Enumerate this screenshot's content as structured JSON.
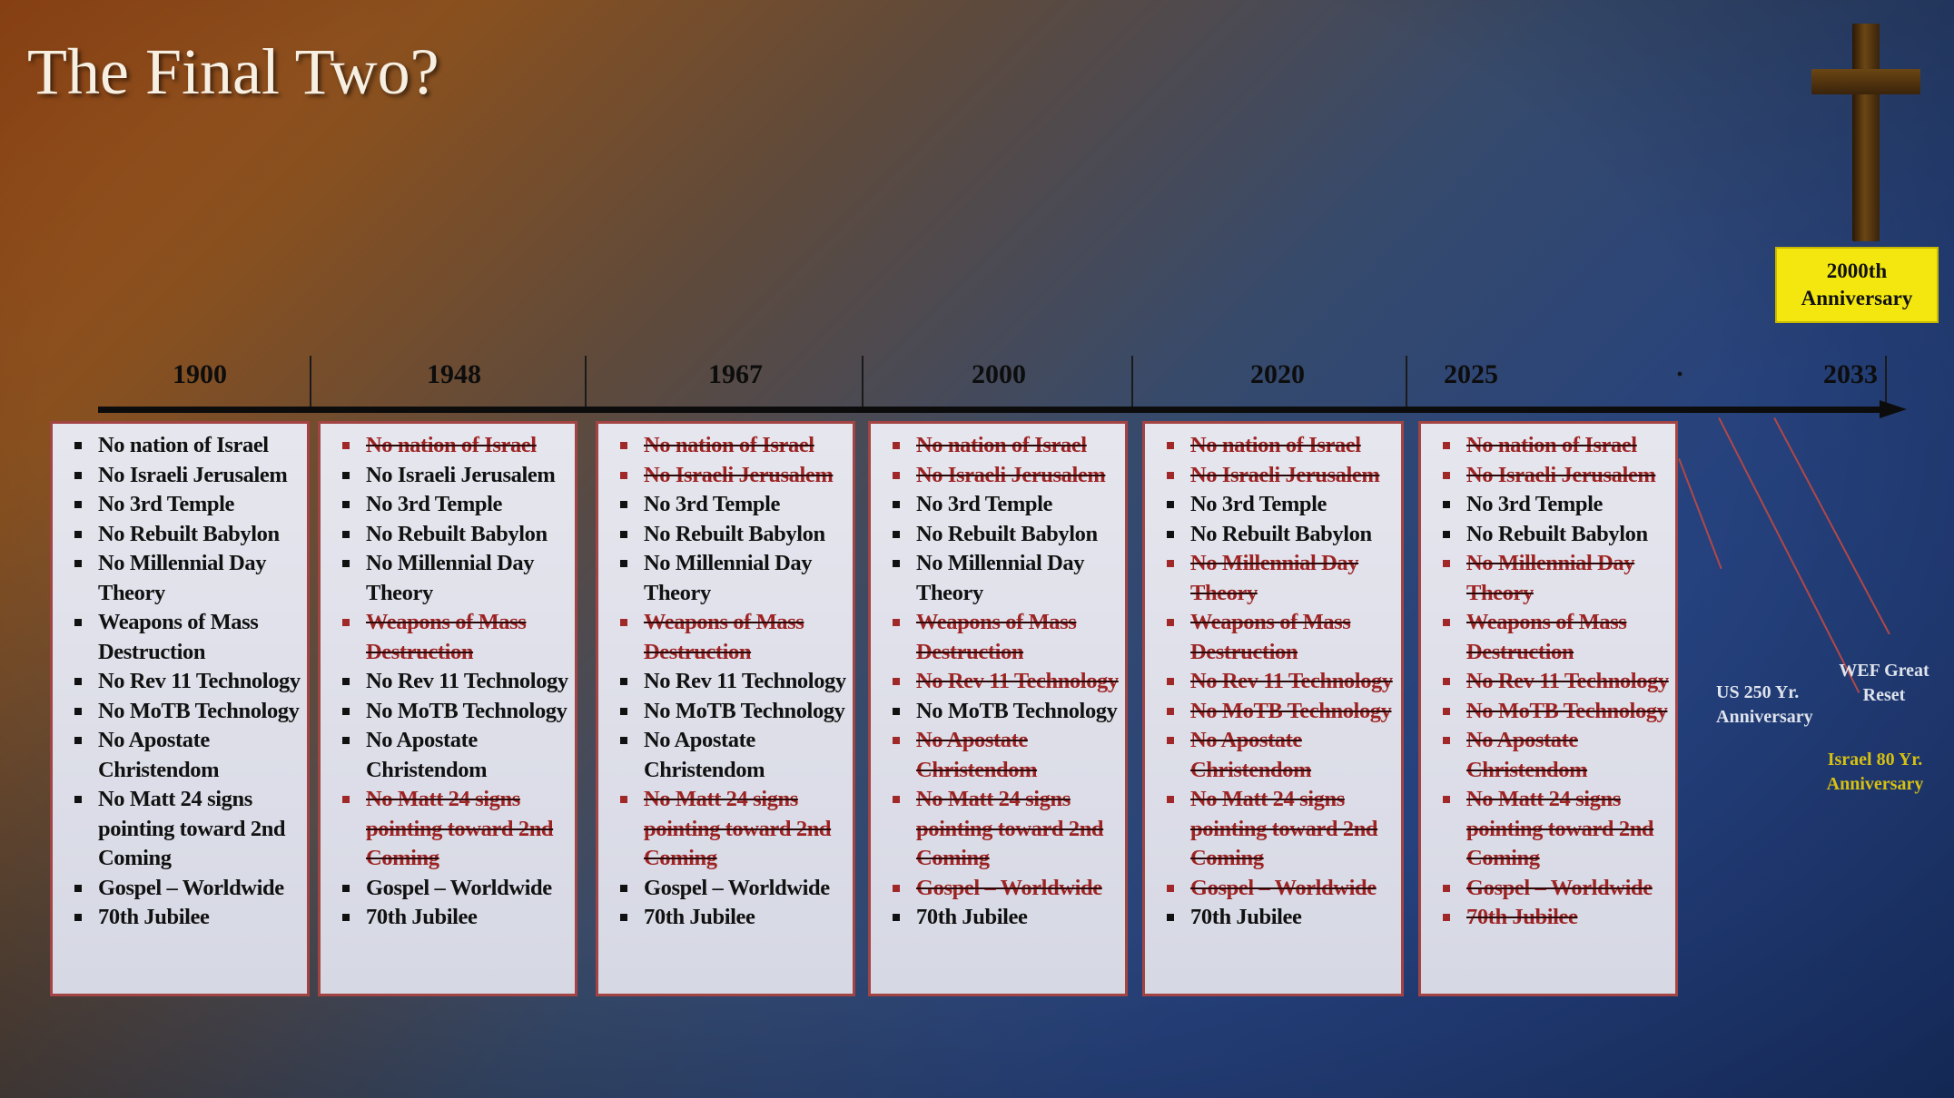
{
  "slide": {
    "title": "The Final Two?",
    "anniversary_label": "2000th Anniversary",
    "years": [
      "1900",
      "1948",
      "1967",
      "2000",
      "2020",
      "2025",
      "·",
      "2033"
    ],
    "columns": [
      {
        "year": "1900",
        "items": [
          {
            "text": "No nation of Israel",
            "struck": false
          },
          {
            "text": "No Israeli Jerusalem",
            "struck": false
          },
          {
            "text": "No 3rd Temple",
            "struck": false
          },
          {
            "text": "No Rebuilt Babylon",
            "struck": false
          },
          {
            "text": "No Millennial Day Theory",
            "struck": false
          },
          {
            "text": "Weapons of Mass Destruction",
            "struck": false
          },
          {
            "text": "No Rev 11 Technology",
            "struck": false
          },
          {
            "text": "No MoTB Technology",
            "struck": false
          },
          {
            "text": "No Apostate Christendom",
            "struck": false
          },
          {
            "text": "No Matt 24 signs pointing toward 2nd Coming",
            "struck": false
          },
          {
            "text": "Gospel – Worldwide",
            "struck": false
          },
          {
            "text": "70th Jubilee",
            "struck": false
          }
        ]
      },
      {
        "year": "1948",
        "items": [
          {
            "text": "No nation of Israel",
            "struck": true
          },
          {
            "text": "No Israeli Jerusalem",
            "struck": false
          },
          {
            "text": "No 3rd Temple",
            "struck": false
          },
          {
            "text": "No Rebuilt Babylon",
            "struck": false
          },
          {
            "text": "No Millennial Day Theory",
            "struck": false
          },
          {
            "text": "Weapons of Mass Destruction",
            "struck": true
          },
          {
            "text": "No Rev 11 Technology",
            "struck": false
          },
          {
            "text": "No MoTB Technology",
            "struck": false
          },
          {
            "text": "No Apostate Christendom",
            "struck": false
          },
          {
            "text": "No Matt 24 signs pointing toward 2nd Coming",
            "struck": true
          },
          {
            "text": "Gospel – Worldwide",
            "struck": false
          },
          {
            "text": "70th Jubilee",
            "struck": false
          }
        ]
      },
      {
        "year": "1967",
        "items": [
          {
            "text": "No nation of Israel",
            "struck": true
          },
          {
            "text": "No Israeli Jerusalem",
            "struck": true
          },
          {
            "text": "No 3rd Temple",
            "struck": false
          },
          {
            "text": "No Rebuilt Babylon",
            "struck": false
          },
          {
            "text": "No Millennial Day Theory",
            "struck": false
          },
          {
            "text": "Weapons of Mass Destruction",
            "struck": true
          },
          {
            "text": "No Rev 11 Technology",
            "struck": false
          },
          {
            "text": "No MoTB Technology",
            "struck": false
          },
          {
            "text": "No Apostate Christendom",
            "struck": false
          },
          {
            "text": "No Matt 24 signs pointing toward 2nd Coming",
            "struck": true
          },
          {
            "text": "Gospel – Worldwide",
            "struck": false
          },
          {
            "text": "70th Jubilee",
            "struck": false
          }
        ]
      },
      {
        "year": "2000",
        "items": [
          {
            "text": "No nation of Israel",
            "struck": true
          },
          {
            "text": "No Israeli Jerusalem",
            "struck": true
          },
          {
            "text": "No 3rd Temple",
            "struck": false
          },
          {
            "text": "No Rebuilt Babylon",
            "struck": false
          },
          {
            "text": "No Millennial Day Theory",
            "struck": false
          },
          {
            "text": "Weapons of Mass Destruction",
            "struck": true
          },
          {
            "text": "No Rev 11 Technology",
            "struck": true
          },
          {
            "text": "No MoTB Technology",
            "struck": false
          },
          {
            "text": "No Apostate Christendom",
            "struck": true
          },
          {
            "text": "No Matt 24 signs pointing toward 2nd Coming",
            "struck": true
          },
          {
            "text": "Gospel – Worldwide",
            "struck": true
          },
          {
            "text": "70th Jubilee",
            "struck": false
          }
        ]
      },
      {
        "year": "2020",
        "items": [
          {
            "text": "No nation of Israel",
            "struck": true
          },
          {
            "text": "No Israeli Jerusalem",
            "struck": true
          },
          {
            "text": "No 3rd Temple",
            "struck": false
          },
          {
            "text": "No Rebuilt Babylon",
            "struck": false
          },
          {
            "text": "No Millennial Day Theory",
            "struck": true
          },
          {
            "text": "Weapons of Mass Destruction",
            "struck": true
          },
          {
            "text": "No Rev 11 Technology",
            "struck": true
          },
          {
            "text": "No MoTB Technology",
            "struck": true
          },
          {
            "text": "No Apostate Christendom",
            "struck": true
          },
          {
            "text": "No Matt 24 signs pointing toward 2nd Coming",
            "struck": true
          },
          {
            "text": "Gospel – Worldwide",
            "struck": true
          },
          {
            "text": "70th Jubilee",
            "struck": false
          }
        ]
      },
      {
        "year": "2025",
        "items": [
          {
            "text": "No nation of Israel",
            "struck": true
          },
          {
            "text": "No Israeli Jerusalem",
            "struck": true
          },
          {
            "text": "No 3rd Temple",
            "struck": false
          },
          {
            "text": "No Rebuilt Babylon",
            "struck": false
          },
          {
            "text": "No Millennial Day Theory",
            "struck": true
          },
          {
            "text": "Weapons of Mass Destruction",
            "struck": true
          },
          {
            "text": "No Rev 11 Technology",
            "struck": true
          },
          {
            "text": "No MoTB Technology",
            "struck": true
          },
          {
            "text": "No Apostate Christendom",
            "struck": true
          },
          {
            "text": "No Matt 24 signs pointing toward 2nd Coming",
            "struck": true
          },
          {
            "text": "Gospel – Worldwide",
            "struck": true
          },
          {
            "text": "70th Jubilee",
            "struck": true
          }
        ]
      }
    ],
    "annotations": {
      "us": "US 250 Yr. Anniversary",
      "wef": "WEF Great Reset",
      "israel": "Israel 80 Yr. Anniversary"
    },
    "colors": {
      "strike_red": "#9e2424",
      "box_border": "#a24444",
      "anniversary_yellow": "#f3e70f",
      "israel_label": "#d6c012"
    }
  }
}
